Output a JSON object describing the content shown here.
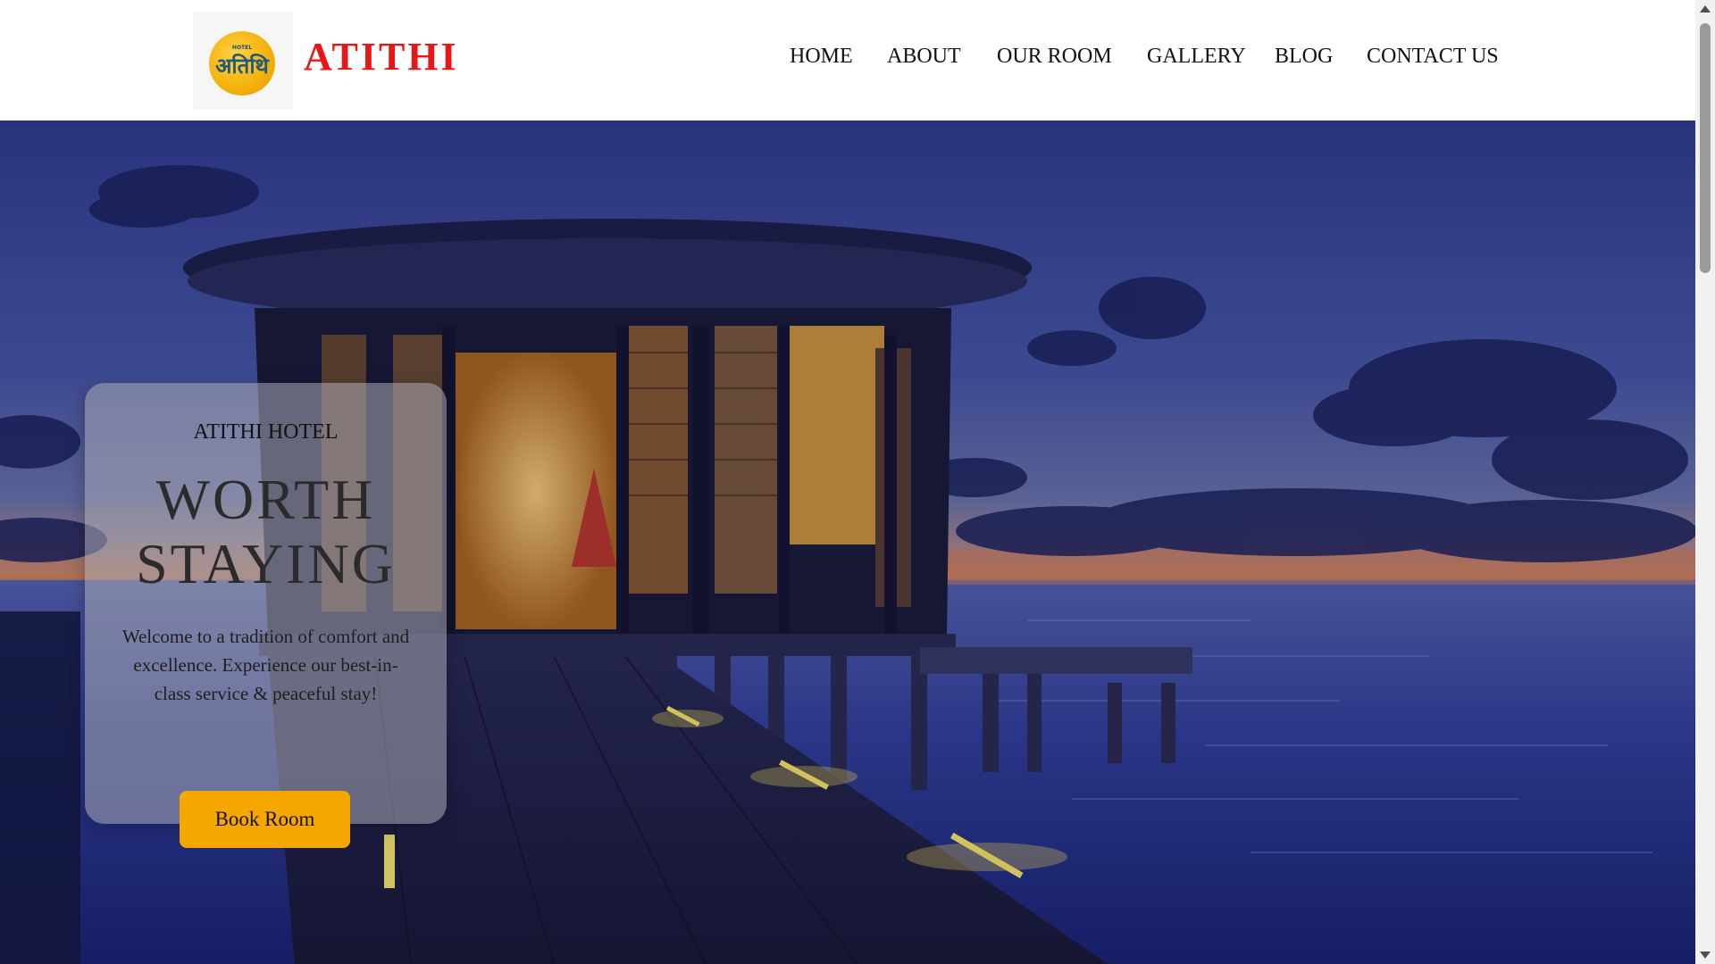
{
  "header": {
    "logo": {
      "small_text": "HOTEL",
      "script_text": "अतिथि"
    },
    "brand": "ATITHI"
  },
  "nav": {
    "items": [
      {
        "label": "HOME"
      },
      {
        "label": "ABOUT"
      },
      {
        "label": "OUR ROOM"
      },
      {
        "label": "GALLERY"
      },
      {
        "label": "BLOG"
      },
      {
        "label": "CONTACT US"
      }
    ]
  },
  "hero": {
    "eyebrow": "ATITHI HOTEL",
    "title_line1": "WORTH",
    "title_line2": "STAYING",
    "description": "Welcome to a tradition of comfort and excellence. Experience our best-in-class service & peaceful stay!",
    "cta_label": "Book Room"
  },
  "colors": {
    "brand_red": "#ea1616",
    "cta_yellow": "#f5a700",
    "logo_yellow": "#f5b30c",
    "header_bg": "#ffffff"
  }
}
